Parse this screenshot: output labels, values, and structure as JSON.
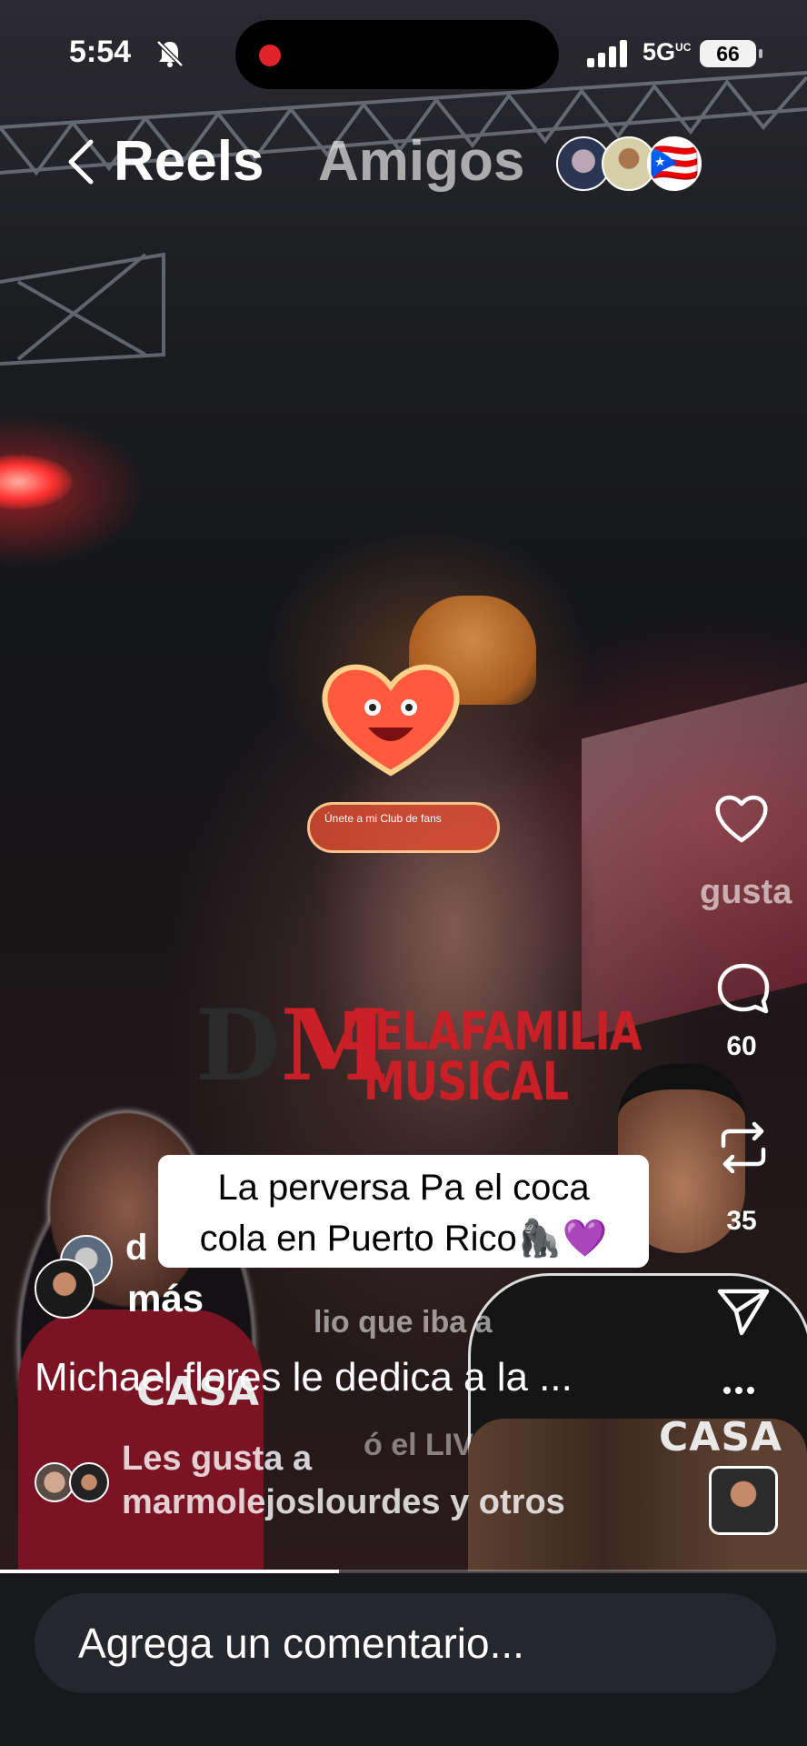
{
  "status_bar": {
    "time": "5:54",
    "network": "5G",
    "network_suffix": "UC",
    "battery": "66"
  },
  "header": {
    "tab_active": "Reels",
    "tab_inactive": "Amigos",
    "flag": "🇵🇷"
  },
  "video": {
    "sticker_label": "Únete a mi Club de fans",
    "watermark_line1": "DELAFAMILIA",
    "watermark_line2": "MUSICAL",
    "shirt_text": "CASA",
    "caption": [
      "La perversa Pa el coca",
      "cola en Puerto Rico🦍💜"
    ],
    "faded_audio": "lio que iba a",
    "faded_live": "ó el LIV"
  },
  "post": {
    "username": "d",
    "more_label": "más",
    "description": "Michael flores le dedica a la ...",
    "liked_line1": "Les gusta a",
    "liked_line2": "marmolejoslourdes y otros"
  },
  "rail": {
    "like_faded": "gusta",
    "comment_count": "60",
    "repost_count": "35"
  },
  "composer": {
    "placeholder": "Agrega un comentario..."
  },
  "playback": {
    "progress_percent": 42
  },
  "colors": {
    "background": "#0b0b0f",
    "composer_bar": "#17191c",
    "accent_red": "#e0242a"
  },
  "icons": [
    "bell-slash-icon",
    "signal-icon",
    "back-chevron-icon",
    "heart-icon",
    "comment-icon",
    "repost-icon",
    "send-icon",
    "more-icon"
  ]
}
